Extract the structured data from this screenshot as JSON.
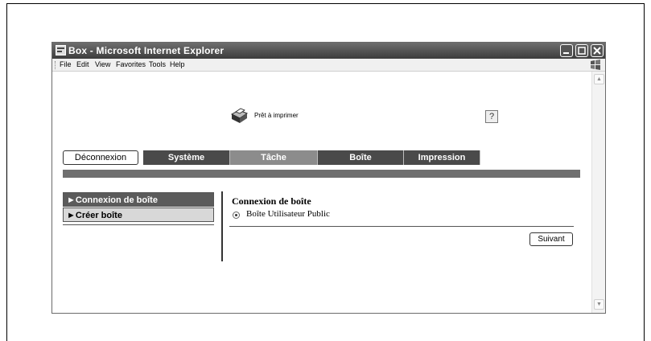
{
  "window": {
    "title": "Box - Microsoft Internet Explorer"
  },
  "menubar": {
    "items": [
      "File",
      "Edit",
      "View",
      "Favorites",
      "Tools",
      "Help"
    ]
  },
  "status": {
    "text": "Prêt à imprimer",
    "icon": "printer-icon"
  },
  "help": {
    "label": "?"
  },
  "toolbar": {
    "logout_label": "Déconnexion",
    "tabs": [
      {
        "label": "Système",
        "active": false
      },
      {
        "label": "Tâche",
        "active": true
      },
      {
        "label": "Boîte",
        "active": false
      },
      {
        "label": "Impression",
        "active": false
      }
    ]
  },
  "sidebar": {
    "items": [
      {
        "label": "►Connexion de boîte",
        "selected": true
      },
      {
        "label": "►Créer boîte",
        "selected": false
      }
    ]
  },
  "main": {
    "title": "Connexion de boîte",
    "option_label": "Boîte Utilisateur Public",
    "next_label": "Suivant"
  },
  "colors": {
    "tab_dark": "#4a4a4a",
    "tab_active": "#8c8c8c",
    "band": "#6f6f6f"
  }
}
